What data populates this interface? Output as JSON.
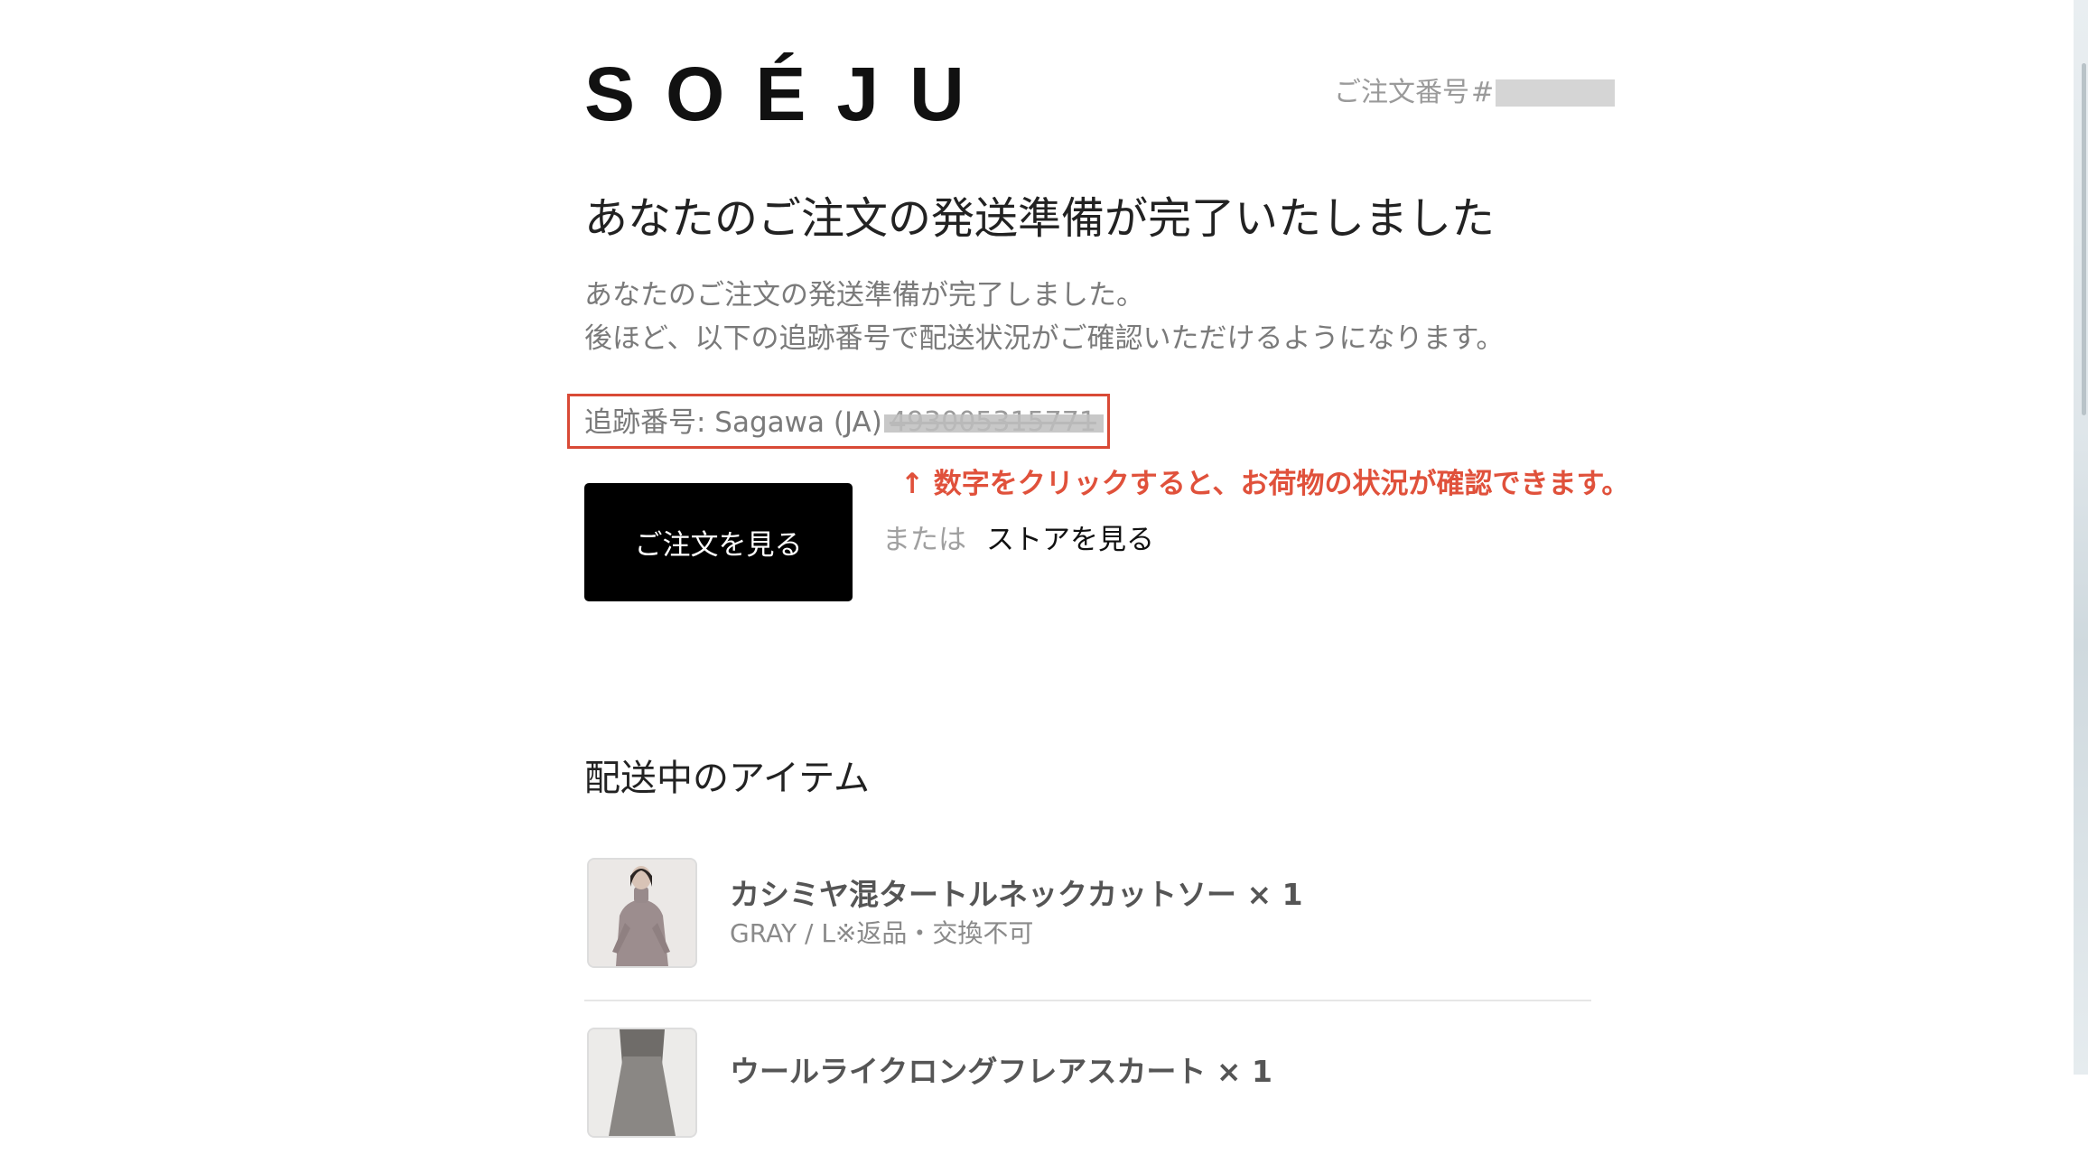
{
  "brand": {
    "logo_text": "SOÉJU"
  },
  "order": {
    "label": "ご注文番号",
    "number_prefix": "#"
  },
  "heading": "あなたのご注文の発送準備が完了いたしました",
  "description": {
    "line1": "あなたのご注文の発送準備が完了しました。",
    "line2": "後ほど、以下の追跡番号で配送状況がご確認いただけるようになります。"
  },
  "tracking": {
    "label": "追跡番号: Sagawa (JA)",
    "number": "493005315771"
  },
  "annotation": {
    "note": "↑ 数字をクリックすると、お荷物の状況が確認できます。",
    "color": "#e0513b"
  },
  "actions": {
    "view_order_label": "ご注文を見る",
    "or_label": "または",
    "view_store_label": "ストアを見る"
  },
  "items_section": {
    "title": "配送中のアイテム",
    "items": [
      {
        "name": "カシミヤ混タートルネックカットソー × 1",
        "variant": "GRAY / L※返品・交換不可",
        "thumbnail": "woman-gray-turtleneck-photo"
      },
      {
        "name": "ウールライクロングフレアスカート × 1",
        "variant": "",
        "thumbnail": "skirt-photo"
      }
    ]
  }
}
